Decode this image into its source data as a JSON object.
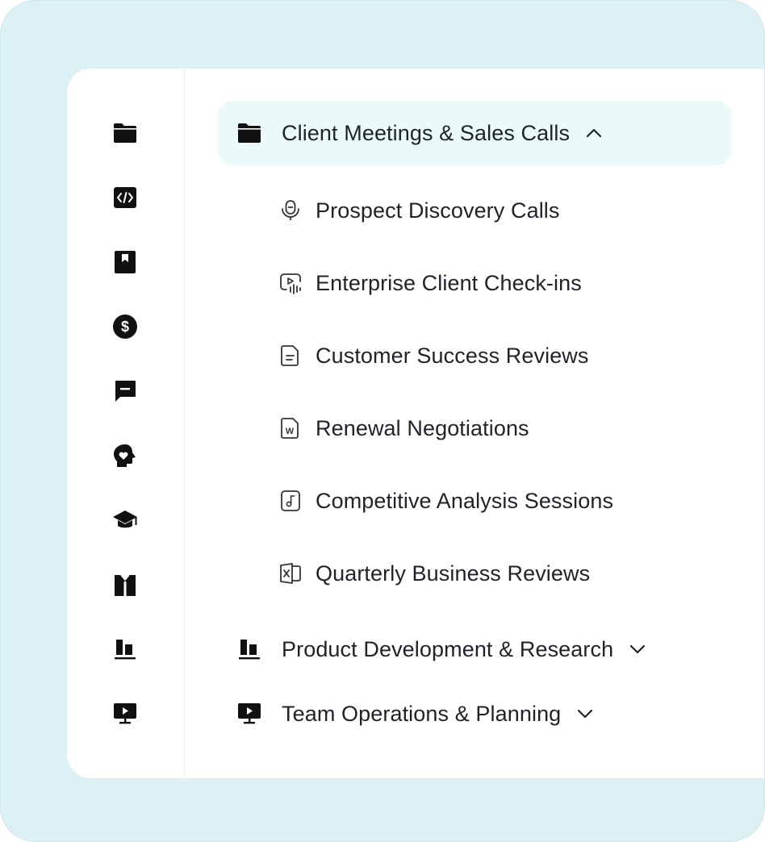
{
  "rail": {
    "icons": [
      {
        "name": "folder-icon"
      },
      {
        "name": "code-icon"
      },
      {
        "name": "bookmark-icon"
      },
      {
        "name": "dollar-icon"
      },
      {
        "name": "message-icon"
      },
      {
        "name": "head-heart-icon"
      },
      {
        "name": "graduation-cap-icon"
      },
      {
        "name": "shirt-icon"
      },
      {
        "name": "bar-chart-icon"
      },
      {
        "name": "presentation-icon"
      }
    ]
  },
  "nav": {
    "groups": [
      {
        "label": "Client Meetings & Sales Calls",
        "icon": "folder-icon",
        "expanded": true,
        "items": [
          {
            "label": "Prospect Discovery Calls",
            "icon": "microphone-icon"
          },
          {
            "label": "Enterprise Client Check-ins",
            "icon": "video-audio-icon"
          },
          {
            "label": "Customer Success Reviews",
            "icon": "document-icon"
          },
          {
            "label": "Renewal Negotiations",
            "icon": "word-document-icon"
          },
          {
            "label": "Competitive Analysis Sessions",
            "icon": "music-file-icon"
          },
          {
            "label": "Quarterly Business Reviews",
            "icon": "excel-file-icon"
          }
        ]
      },
      {
        "label": "Product Development & Research",
        "icon": "bar-chart-icon",
        "expanded": false
      },
      {
        "label": "Team Operations & Planning",
        "icon": "presentation-icon",
        "expanded": false
      }
    ]
  },
  "colors": {
    "frame": "#dbf1f3",
    "active_group_bg": "#eafafb",
    "text": "#1f2328",
    "icon": "#111111"
  }
}
